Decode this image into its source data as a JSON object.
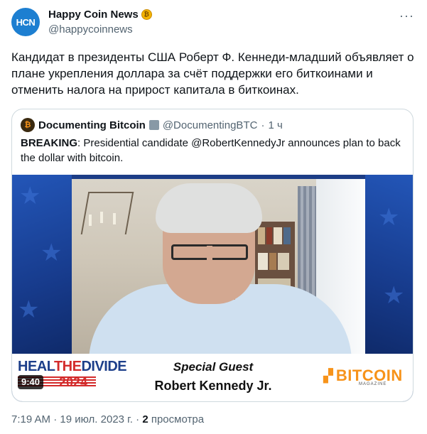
{
  "author": {
    "avatar_text": "HCN",
    "name": "Happy Coin News",
    "badge_icon": "gold-coin-badge",
    "handle": "@happycoinnews"
  },
  "tweet": {
    "text": "Кандидат в президенты США Роберт Ф. Кеннеди-младший объявляет о плане укрепления доллара за счёт поддержки его биткоинами и отменить налога на прирост капитала в биткоинах."
  },
  "quote": {
    "name": "Documenting Bitcoin",
    "handle": "@DocumentingBTC",
    "dot": "·",
    "time": "1 ч",
    "text_bold": "BREAKING",
    "text_rest": ": Presidential candidate @RobertKennedyJr announces plan to back the dollar with bitcoin.",
    "video": {
      "duration": "9:40",
      "show_logo_left": "HEALTHEDIVIDE",
      "show_logo_left_the": "THE",
      "show_logo_left_heal": "HEAL",
      "show_logo_left_divide": "DIVIDE",
      "show_logo_year": "2024",
      "guest_title": "Special Guest",
      "guest_name": "Robert Kennedy Jr.",
      "brand_logo": "BITCOIN",
      "brand_sub": "MAGAZINE"
    }
  },
  "meta": {
    "time": "7:19 AM",
    "dot": "·",
    "date": "19 июл. 2023 г.",
    "dot2": "·",
    "views_count": "2",
    "views_label": "просмотра"
  },
  "colors": {
    "accent": "#1d9bf0",
    "bitcoin": "#f7931a",
    "video_bg": "#1c3d86"
  }
}
